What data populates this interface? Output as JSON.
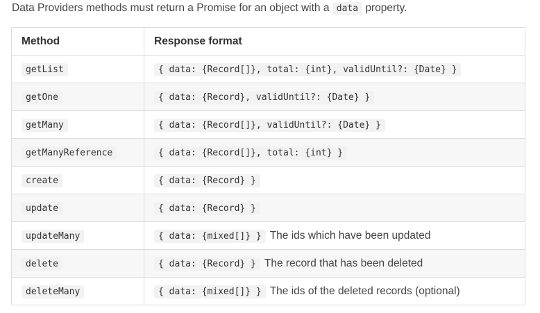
{
  "intro": {
    "text_before": "Data Providers methods must return a Promise for an object with a",
    "code": "data",
    "text_after": "property."
  },
  "table": {
    "headers": [
      "Method",
      "Response format"
    ],
    "rows": [
      {
        "method": "getList",
        "format": "{ data: {Record[]}, total: {int}, validUntil?: {Date} }",
        "note": ""
      },
      {
        "method": "getOne",
        "format": "{ data: {Record}, validUntil?: {Date} }",
        "note": ""
      },
      {
        "method": "getMany",
        "format": "{ data: {Record[]}, validUntil?: {Date} }",
        "note": ""
      },
      {
        "method": "getManyReference",
        "format": "{ data: {Record[]}, total: {int} }",
        "note": ""
      },
      {
        "method": "create",
        "format": "{ data: {Record} }",
        "note": ""
      },
      {
        "method": "update",
        "format": "{ data: {Record} }",
        "note": ""
      },
      {
        "method": "updateMany",
        "format": "{ data: {mixed[]} }",
        "note": "The ids which have been updated"
      },
      {
        "method": "delete",
        "format": "{ data: {Record} }",
        "note": "The record that has been deleted"
      },
      {
        "method": "deleteMany",
        "format": "{ data: {mixed[]} }",
        "note": "The ids of the deleted records (optional)"
      }
    ]
  }
}
